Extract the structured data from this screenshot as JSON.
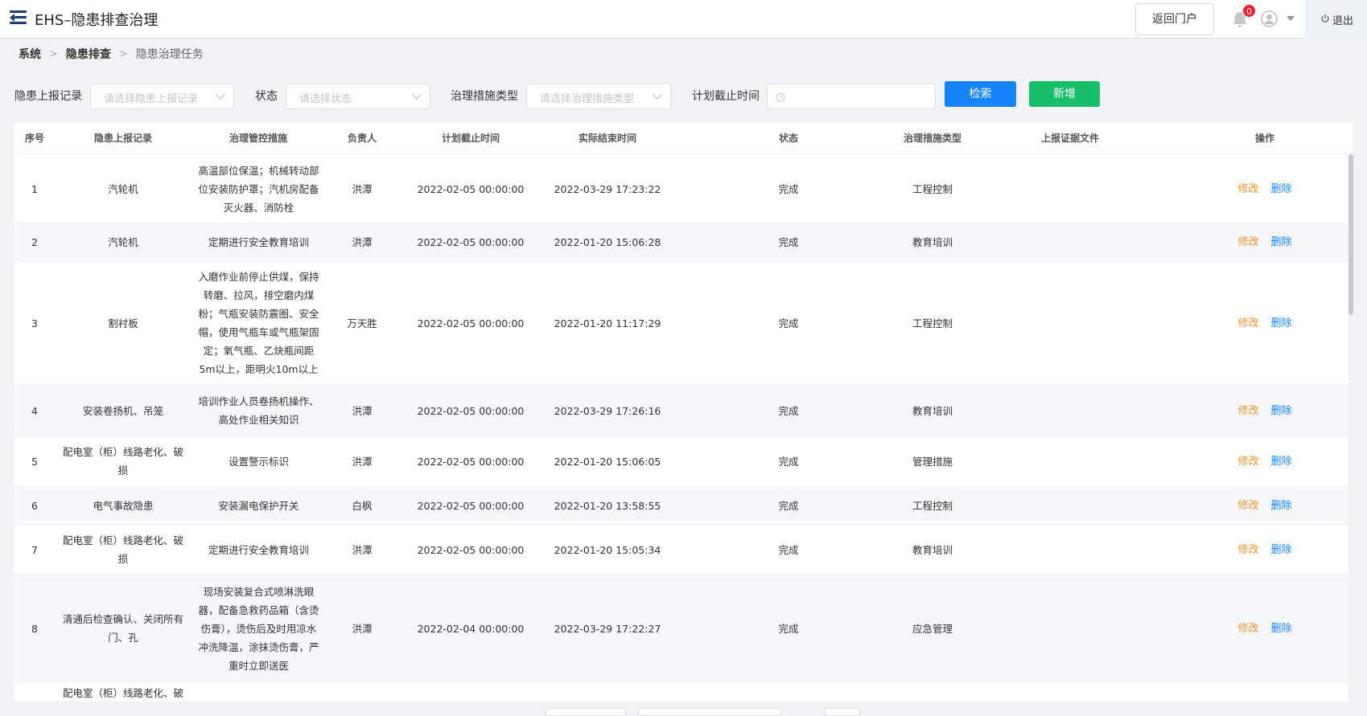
{
  "app": {
    "title": "EHS–隐患排查治理"
  },
  "header": {
    "portal_button": "返回门户",
    "notification_count": "0",
    "logout_label": "退出"
  },
  "breadcrumb": {
    "items": [
      "系统",
      "隐患排查",
      "隐患治理任务"
    ]
  },
  "filters": {
    "record_label": "隐患上报记录",
    "record_placeholder": "请选择隐患上报记录",
    "status_label": "状态",
    "status_placeholder": "请选择状态",
    "type_label": "治理措施类型",
    "type_placeholder": "请选择治理措施类型",
    "deadline_label": "计划截止时间",
    "search_button": "检索",
    "add_button": "新增"
  },
  "table": {
    "columns": [
      "序号",
      "隐患上报记录",
      "治理管控措施",
      "负责人",
      "计划截止时间",
      "实际结束时间",
      "状态",
      "治理措施类型",
      "上报证据文件",
      "操作"
    ],
    "edit_label": "修改",
    "delete_label": "删除",
    "rows": [
      {
        "no": "1",
        "record": "汽轮机",
        "measure": "高温部位保温；机械转动部位安装防护罩；汽机房配备灭火器、消防栓",
        "owner": "洪潭",
        "plan": "2022-02-05 00:00:00",
        "actual": "2022-03-29 17:23:22",
        "status": "完成",
        "type": "工程控制"
      },
      {
        "no": "2",
        "record": "汽轮机",
        "measure": "定期进行安全教育培训",
        "owner": "洪潭",
        "plan": "2022-02-05 00:00:00",
        "actual": "2022-01-20 15:06:28",
        "status": "完成",
        "type": "教育培训"
      },
      {
        "no": "3",
        "record": "割衬板",
        "measure": "入磨作业前停止供煤，保持转磨、拉风，排空磨内煤粉；气瓶安装防震圈、安全帽，使用气瓶车或气瓶架固定；氧气瓶、乙炔瓶间距5m以上，距明火10m以上",
        "owner": "万天胜",
        "plan": "2022-02-05 00:00:00",
        "actual": "2022-01-20 11:17:29",
        "status": "完成",
        "type": "工程控制"
      },
      {
        "no": "4",
        "record": "安装卷扬机、吊笼",
        "measure": "培训作业人员卷扬机操作、高处作业相关知识",
        "owner": "洪潭",
        "plan": "2022-02-05 00:00:00",
        "actual": "2022-03-29 17:26:16",
        "status": "完成",
        "type": "教育培训"
      },
      {
        "no": "5",
        "record": "配电室（柜）线路老化、破损",
        "measure": "设置警示标识",
        "owner": "洪潭",
        "plan": "2022-02-05 00:00:00",
        "actual": "2022-01-20 15:06:05",
        "status": "完成",
        "type": "管理措施"
      },
      {
        "no": "6",
        "record": "电气事故隐患",
        "measure": "安装漏电保护开关",
        "owner": "白枫",
        "plan": "2022-02-05 00:00:00",
        "actual": "2022-01-20 13:58:55",
        "status": "完成",
        "type": "工程控制"
      },
      {
        "no": "7",
        "record": "配电室（柜）线路老化、破损",
        "measure": "定期进行安全教育培训",
        "owner": "洪潭",
        "plan": "2022-02-05 00:00:00",
        "actual": "2022-01-20 15:05:34",
        "status": "完成",
        "type": "教育培训"
      },
      {
        "no": "8",
        "record": "清通后检查确认、关闭所有门、孔",
        "measure": "现场安装复合式喷淋洗眼器，配备急救药品箱（含烫伤膏），烫伤后及时用凉水冲洗降温，涂抹烫伤膏，严重时立即送医",
        "owner": "洪潭",
        "plan": "2022-02-04 00:00:00",
        "actual": "2022-03-29 17:22:27",
        "status": "完成",
        "type": "应急管理"
      },
      {
        "no": "",
        "record": "配电室（柜）线路老化、破",
        "measure": "",
        "owner": "",
        "plan": "",
        "actual": "",
        "status": "",
        "type": ""
      }
    ]
  }
}
